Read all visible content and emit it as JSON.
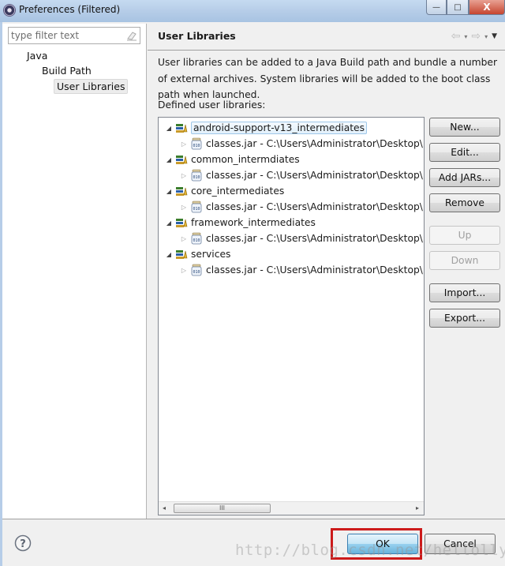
{
  "window": {
    "title": "Preferences (Filtered)",
    "minimize_glyph": "—",
    "maximize_glyph": "□",
    "close_glyph": "X"
  },
  "sidebar": {
    "filter_placeholder": "type filter text",
    "filter_value": "",
    "items": [
      {
        "label": "Java",
        "level": 0
      },
      {
        "label": "Build Path",
        "level": 1
      },
      {
        "label": "User Libraries",
        "level": 2,
        "selected": true
      }
    ]
  },
  "page": {
    "title": "User Libraries",
    "description": "User libraries can be added to a Java Build path and bundle a number of external archives. System libraries will be added to the boot class path when launched.",
    "defined_label": "Defined user libraries:",
    "nav": {
      "back_glyph": "⇦",
      "forward_glyph": "⇨",
      "dropdown_glyph": "▾",
      "menu_glyph": "▼"
    }
  },
  "libraries": [
    {
      "name": "android-support-v13_intermediates",
      "selected": true,
      "entry": "classes.jar - C:\\Users\\Administrator\\Desktop\\la"
    },
    {
      "name": "common_intermdiates",
      "selected": false,
      "entry": "classes.jar - C:\\Users\\Administrator\\Desktop\\la"
    },
    {
      "name": "core_intermediates",
      "selected": false,
      "entry": "classes.jar - C:\\Users\\Administrator\\Desktop\\la"
    },
    {
      "name": "framework_intermediates",
      "selected": false,
      "entry": "classes.jar - C:\\Users\\Administrator\\Desktop\\la"
    },
    {
      "name": "services",
      "selected": false,
      "entry": "classes.jar - C:\\Users\\Administrator\\Desktop\\la"
    }
  ],
  "tree": {
    "expanded_glyph": "◢",
    "collapsed_glyph": "▷",
    "scroll_left": "◂",
    "scroll_right": "▸",
    "thumb_grip": "III"
  },
  "buttons": {
    "new": "New...",
    "edit": "Edit...",
    "add_jars": "Add JARs...",
    "remove": "Remove",
    "up": "Up",
    "down": "Down",
    "import": "Import...",
    "export": "Export...",
    "ok": "OK",
    "cancel": "Cancel"
  },
  "watermark": "http://blog.csdn.net/hellollyewen",
  "colors": {
    "highlight_box": "#cc1a1a",
    "selection_border": "#9ec7e8",
    "default_button": "#68b3db"
  }
}
